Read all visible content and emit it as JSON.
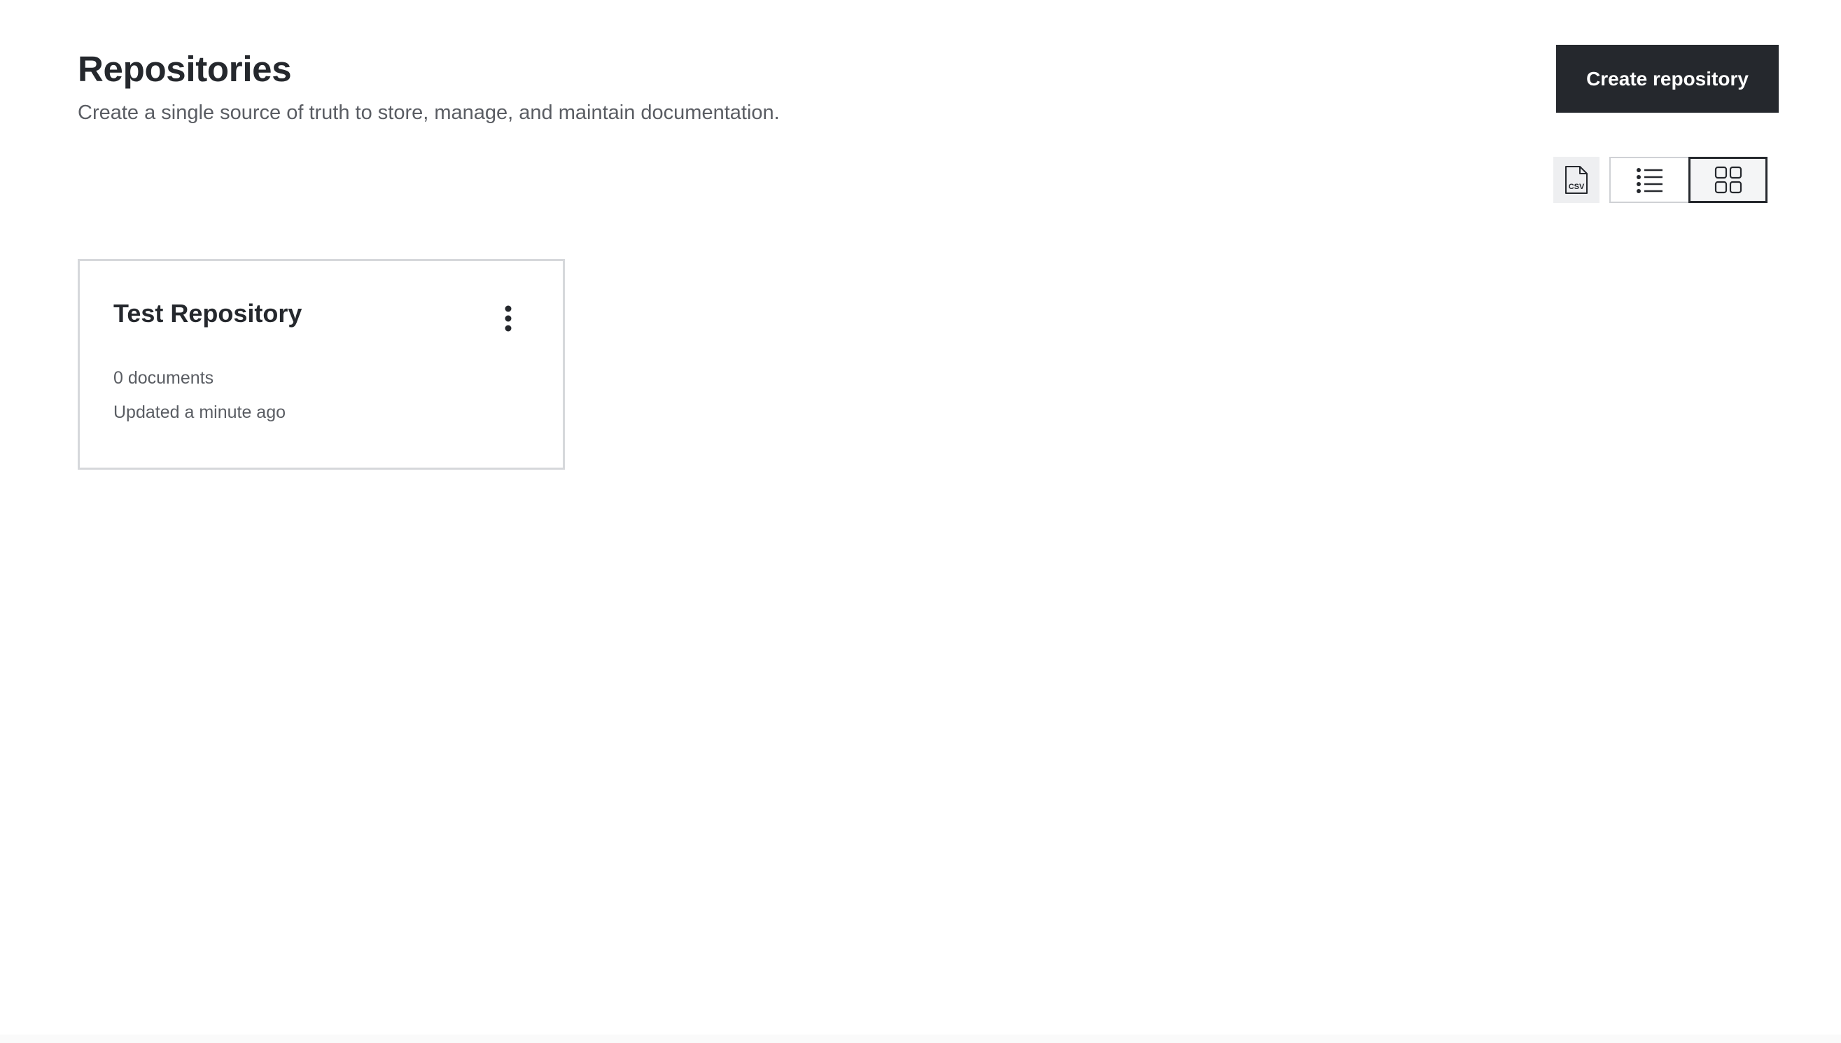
{
  "header": {
    "title": "Repositories",
    "subtitle": "Create a single source of truth to store, manage, and maintain documentation.",
    "create_button_label": "Create repository"
  },
  "toolbar": {
    "csv_icon": "csv-file-icon",
    "csv_icon_text": "CSV",
    "views": [
      {
        "name": "list",
        "icon": "list-icon",
        "active": false
      },
      {
        "name": "grid",
        "icon": "grid-icon",
        "active": true
      }
    ]
  },
  "repositories": [
    {
      "name": "Test Repository",
      "documents": "0 documents",
      "updated": "Updated a minute ago",
      "menu_icon": "more-vertical-icon"
    }
  ],
  "colors": {
    "primary_dark": "#25282d",
    "text_secondary": "#5a5d63",
    "border": "#d6d8db",
    "background": "#ffffff"
  }
}
